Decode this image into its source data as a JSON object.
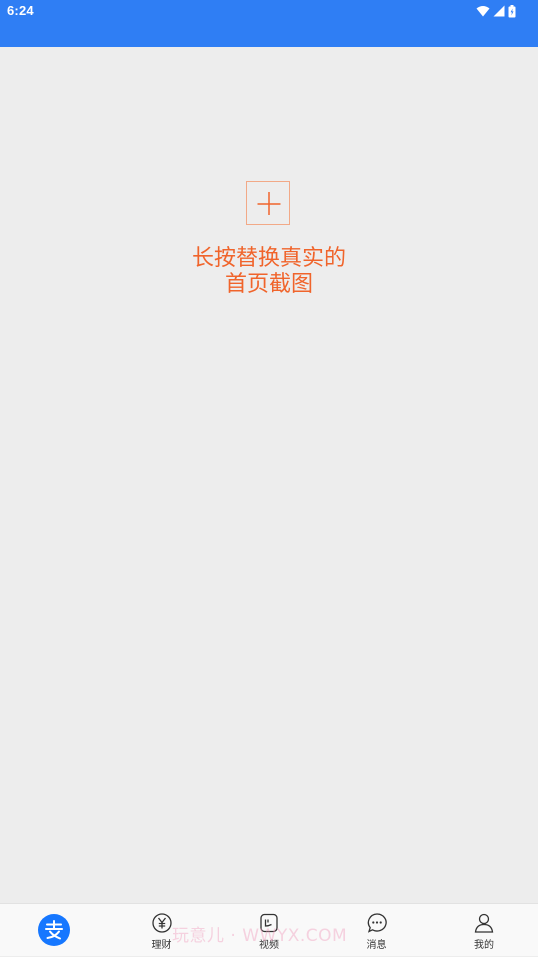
{
  "status_bar": {
    "time": "6:24",
    "icons": [
      "wifi-icon",
      "signal-icon",
      "battery-icon"
    ],
    "background": "#2f7ef4"
  },
  "main": {
    "add_icon": "plus-icon",
    "hint_line1": "长按替换真实的",
    "hint_line2": "首页截图",
    "accent_color": "#f0642b",
    "background": "#ededed"
  },
  "tab_bar": {
    "items": [
      {
        "label": "",
        "icon": "alipay-logo-icon"
      },
      {
        "label": "理财",
        "icon": "yen-icon"
      },
      {
        "label": "视频",
        "icon": "video-icon"
      },
      {
        "label": "消息",
        "icon": "message-icon"
      },
      {
        "label": "我的",
        "icon": "person-icon"
      }
    ],
    "brand_color": "#1677ff"
  },
  "watermark": "玩意儿 · WWYX.COM"
}
